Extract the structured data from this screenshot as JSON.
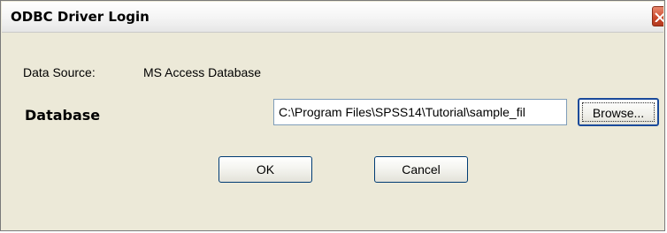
{
  "window": {
    "title": "ODBC Driver Login",
    "close_icon": "close-icon"
  },
  "form": {
    "data_source_label": "Data Source:",
    "data_source_value": "MS Access Database",
    "database_label": "Database",
    "database_value": "C:\\Program Files\\SPSS14\\Tutorial\\sample_fil"
  },
  "buttons": {
    "browse_label": "Browse...",
    "ok_label": "OK",
    "cancel_label": "Cancel"
  },
  "colors": {
    "dialog_bg": "#ece9d8",
    "close_button": "#c9472a",
    "button_border": "#003c74"
  }
}
